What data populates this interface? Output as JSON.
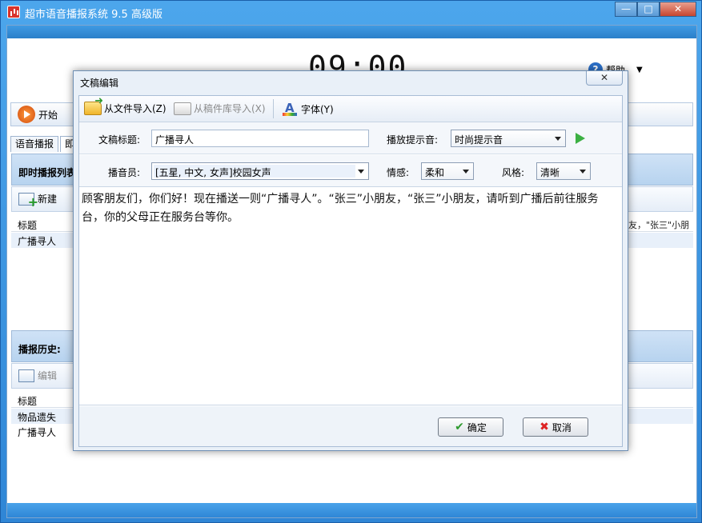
{
  "app": {
    "title": "超市语音播报系统 9.5 高级版",
    "clock": "09:00",
    "help_label": "帮助",
    "start_label": "开始"
  },
  "main_tabs": [
    "语音播报",
    "即时"
  ],
  "instant_panel": {
    "heading": "即时播报列表",
    "new_label": "新建",
    "column_title": "标题",
    "rows": [
      "广播寻人"
    ],
    "clipped_text": "友，\"张三\"小朋"
  },
  "history_panel": {
    "heading": "播报历史:",
    "edit_label": "编辑",
    "column_title": "标题",
    "rows": [
      "物品遗失",
      "广播寻人"
    ]
  },
  "dialog": {
    "title": "文稿编辑",
    "toolbar": {
      "import_file": "从文件导入(Z)",
      "import_library": "从稿件库导入(X)",
      "font": "字体(Y)"
    },
    "fields": {
      "title_label": "文稿标题:",
      "title_value": "广播寻人",
      "prompt_label": "播放提示音:",
      "prompt_value": "时尚提示音",
      "announcer_label": "播音员:",
      "announcer_value": "[五星, 中文, 女声]校园女声",
      "emotion_label": "情感:",
      "emotion_value": "柔和",
      "style_label": "风格:",
      "style_value": "清晰"
    },
    "content": "顾客朋友们，你们好！现在播送一则“广播寻人”。“张三”小朋友，“张三”小朋友，请听到广播后前往服务台，你的父母正在服务台等你。",
    "ok_label": "确定",
    "cancel_label": "取消"
  }
}
